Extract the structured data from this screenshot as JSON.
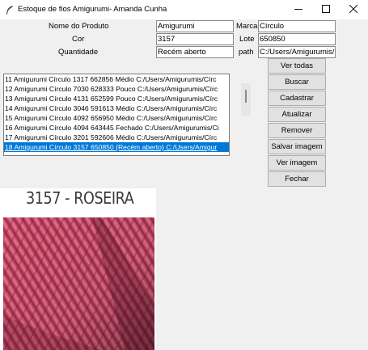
{
  "window": {
    "title": "Estoque de fios Amigurumi- Amanda Cunha"
  },
  "form": {
    "nome_produto": {
      "label": "Nome do Produto",
      "value": "Amigurumi"
    },
    "marca": {
      "label": "Marca",
      "value": "Círculo"
    },
    "cor": {
      "label": "Cor",
      "value": "3157"
    },
    "lote": {
      "label": "Lote",
      "value": "650850"
    },
    "quantidade": {
      "label": "Quantidade",
      "value": "Recém aberto"
    },
    "path": {
      "label": "path",
      "value": "C:/Users/Amigurumis/"
    }
  },
  "list": {
    "rows": [
      "11 Amigurumi Círculo 1317 662856 Médio C:/Users/Amigurumis/Círc",
      "12 Amigurumi Círculo 7030 628333 Pouco C:/Users/Amigurumis/Círc",
      "13 Amigurumi Círculo 4131 652599 Pouco C:/Users/Amigurumis/Círc",
      "14 Amigurumi Círculo 3046 591613 Médio C:/Users/Amigurumis/Círc",
      "15 Amigurumi Círculo 4092 656950 Médio C:/Users/Amigurumis/Círc",
      "16 Amigurumi Círculo 4094 643445 Fechado C:/Users/Amigurumis/Ci",
      "17 Amigurumi Círculo 3201 592606 Médio C:/Users/Amigurumis/Círc",
      "18 Amigurumi Círculo 3157 650850 {Recém aberto} C:/Users/Amigur"
    ],
    "selected_index": 7
  },
  "buttons": {
    "ver_todas": "Ver todas",
    "buscar": "Buscar",
    "cadastrar": "Cadastrar",
    "atualizar": "Atualizar",
    "remover": "Remover",
    "salvar_imagem": "Salvar imagem",
    "ver_imagem": "Ver imagem",
    "fechar": "Fechar"
  },
  "image": {
    "caption": "3157 - ROSEIRA"
  },
  "colors": {
    "selection": "#0078d7",
    "yarn": "#c94a69",
    "window_bg": "#f0f0f0"
  },
  "icons": {
    "app": "feather-icon",
    "minimize": "minimize-icon",
    "maximize": "maximize-icon",
    "close": "close-icon"
  }
}
